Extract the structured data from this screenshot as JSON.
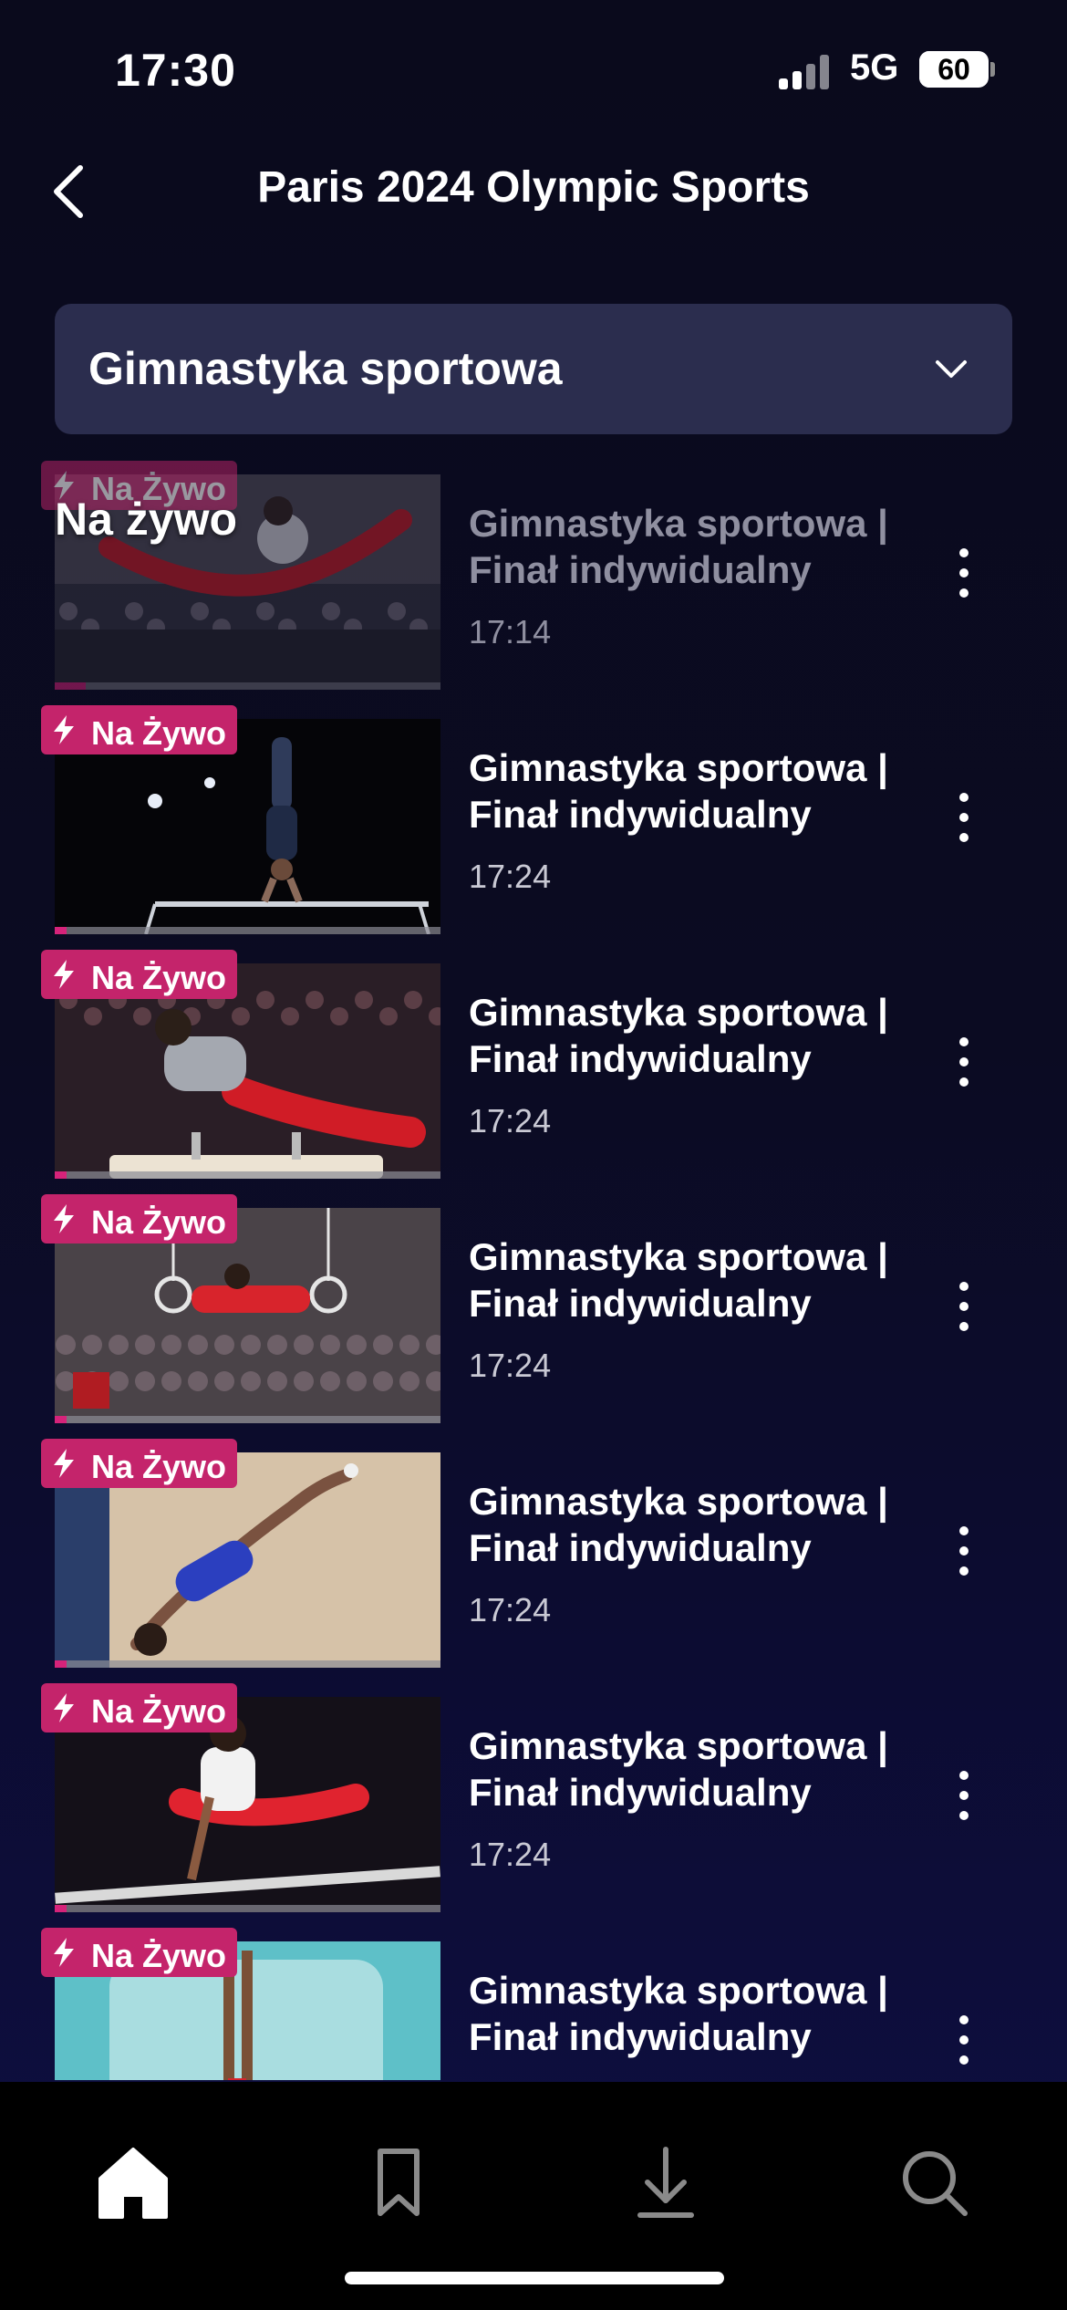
{
  "status_bar": {
    "time": "17:30",
    "network": "5G",
    "battery_level": 60,
    "battery_label": "60"
  },
  "header": {
    "title": "Paris 2024 Olympic Sports"
  },
  "dropdown": {
    "selected": "Gimnastyka sportowa"
  },
  "overlay": {
    "live_text": "Na żywo"
  },
  "items": [
    {
      "badge": "Na Żywo",
      "title": "Gimnastyka sportowa | Finał indywidualny",
      "time": "17:14",
      "progress": 0.08,
      "scene": "pommel-red",
      "dimmed": true
    },
    {
      "badge": "Na Żywo",
      "title": "Gimnastyka sportowa | Finał indywidualny",
      "time": "17:24",
      "progress": 0.03,
      "scene": "high-bar",
      "dimmed": false
    },
    {
      "badge": "Na Żywo",
      "title": "Gimnastyka sportowa | Finał indywidualny",
      "time": "17:24",
      "progress": 0.03,
      "scene": "pommel-horse",
      "dimmed": false
    },
    {
      "badge": "Na Żywo",
      "title": "Gimnastyka sportowa | Finał indywidualny",
      "time": "17:24",
      "progress": 0.03,
      "scene": "rings",
      "dimmed": false
    },
    {
      "badge": "Na Żywo",
      "title": "Gimnastyka sportowa | Finał indywidualny",
      "time": "17:24",
      "progress": 0.03,
      "scene": "floor",
      "dimmed": false
    },
    {
      "badge": "Na Żywo",
      "title": "Gimnastyka sportowa | Finał indywidualny",
      "time": "17:24",
      "progress": 0.03,
      "scene": "parallel-bars",
      "dimmed": false
    },
    {
      "badge": "Na Żywo",
      "title": "Gimnastyka sportowa | Finał indywidualny",
      "time": "",
      "progress": 0.03,
      "scene": "vault",
      "dimmed": false
    }
  ],
  "tabs": [
    {
      "icon": "home-icon",
      "active": true
    },
    {
      "icon": "bookmark-icon",
      "active": false
    },
    {
      "icon": "download-icon",
      "active": false
    },
    {
      "icon": "search-icon",
      "active": false
    }
  ],
  "colors": {
    "accent": "#c4246b",
    "dropdown_bg": "#2b2d4e",
    "background": "#0a0a1c"
  }
}
